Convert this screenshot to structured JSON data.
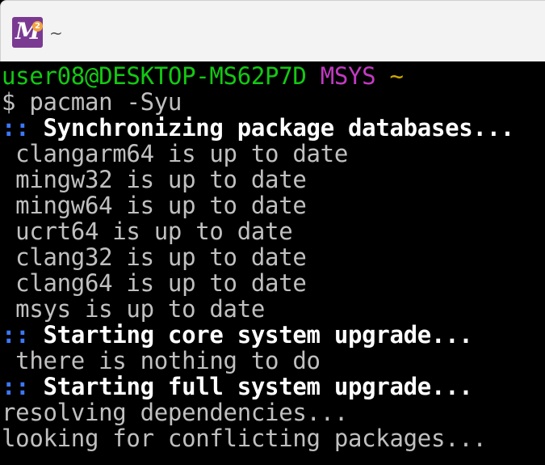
{
  "window": {
    "tab_title": "~",
    "icon_letter": "M",
    "icon_badge": "2"
  },
  "colors": {
    "user_host": "#13c913",
    "msystem": "#c23ac2",
    "cwd": "#cca800",
    "marker": "#3b78ff",
    "heading": "#ffffff",
    "output": "#c0c0c0",
    "background": "#000000"
  },
  "terminal": {
    "prompt": {
      "user_host": "user08@DESKTOP-MS62P7D",
      "msystem": "MSYS",
      "cwd": "~"
    },
    "command_prompt": "$ ",
    "command": "pacman -Syu",
    "sections": [
      {
        "marker": "::",
        "heading": "Synchronizing package databases...",
        "lines": [
          " clangarm64 is up to date",
          " mingw32 is up to date",
          " mingw64 is up to date",
          " ucrt64 is up to date",
          " clang32 is up to date",
          " clang64 is up to date",
          " msys is up to date"
        ]
      },
      {
        "marker": "::",
        "heading": "Starting core system upgrade...",
        "lines": [
          " there is nothing to do"
        ]
      },
      {
        "marker": "::",
        "heading": "Starting full system upgrade...",
        "lines": [
          "resolving dependencies...",
          "looking for conflicting packages..."
        ]
      }
    ]
  }
}
